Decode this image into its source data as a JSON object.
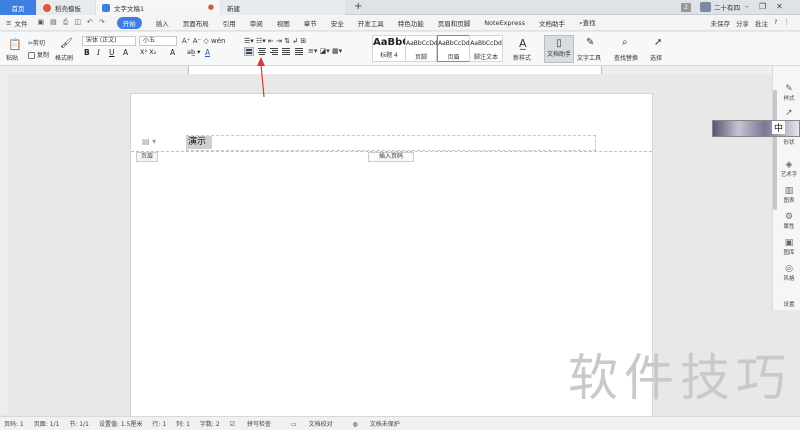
{
  "tabs": {
    "home": "首页",
    "template": "稻壳模板",
    "document": "文字文稿1",
    "new": "新建"
  },
  "top_right": {
    "badge": "2",
    "user": "二十有四"
  },
  "menu": {
    "file": "文件",
    "items": [
      "开始",
      "插入",
      "页面布局",
      "引用",
      "审阅",
      "视图",
      "章节",
      "安全",
      "开发工具",
      "特色功能",
      "页眉和页脚",
      "NoteExpress",
      "文档助手",
      "查找"
    ],
    "right": [
      "未保存",
      "分享",
      "批注"
    ]
  },
  "ribbon": {
    "paste": "粘贴",
    "cut": "剪切",
    "copy": "复制",
    "format_painter": "格式刷",
    "font": "宋体 (正文)",
    "size": "小五",
    "styles": [
      {
        "sample": "AaBbC",
        "name": "标题 4"
      },
      {
        "sample": "AaBbCcDd",
        "name": "页脚"
      },
      {
        "sample": "AaBbCcDd",
        "name": "页眉"
      },
      {
        "sample": "AaBbCcDd",
        "name": "脚注文本"
      }
    ],
    "new_style": "新样式",
    "doc_assistant": "文档助手",
    "text_tools": "文字工具",
    "find_replace": "查找替换",
    "select": "选择"
  },
  "document": {
    "header_text": "演示",
    "header_label": "页眉",
    "insert_page_number": "插入页码"
  },
  "side_panel": [
    "样式",
    "选择",
    "形状",
    "艺术字",
    "图表",
    "属性",
    "图库",
    "风格",
    "设置"
  ],
  "ime": "中",
  "watermark": "软件技巧",
  "status": {
    "page": "页码: 1",
    "pages": "页面: 1/1",
    "section": "节: 1/1",
    "setting": "设置值: 1.5厘米",
    "row": "行: 1",
    "col": "列: 1",
    "words": "字数: 2",
    "spell": "拼写检查",
    "proof": "文档校对",
    "protect": "文档未保护"
  },
  "colors": {
    "accent": "#3d7fe0",
    "arrow": "#d9373a"
  }
}
